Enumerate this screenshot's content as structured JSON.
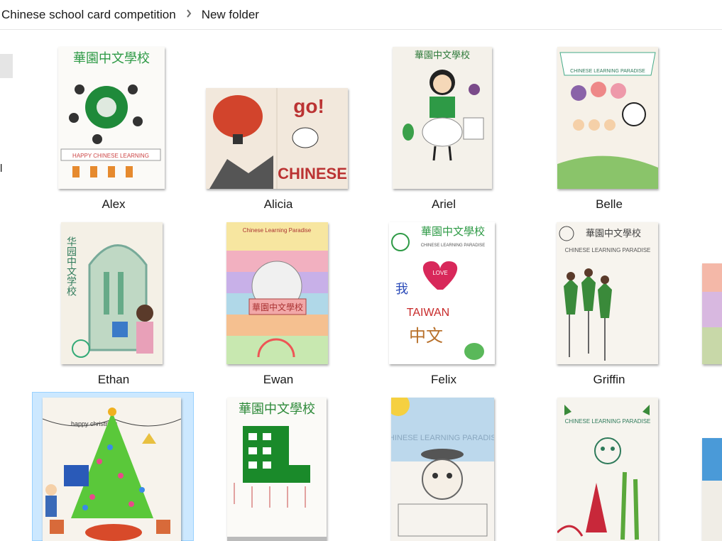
{
  "breadcrumb": {
    "items": [
      "Chinese school card competition",
      "New folder"
    ],
    "separator_icon": "chevron-right-icon"
  },
  "nav_pane": {
    "partial_label": "l"
  },
  "files": [
    {
      "name": "Alex"
    },
    {
      "name": "Alicia"
    },
    {
      "name": "Ariel"
    },
    {
      "name": "Belle"
    },
    {
      "name": "Ethan"
    },
    {
      "name": "Ewan"
    },
    {
      "name": "Felix"
    },
    {
      "name": "Griffin"
    }
  ],
  "thumbnail_text": {
    "school_name": "華園中文學校",
    "alex_banner": "HAPPY CHINESE LEARNING",
    "alicia_go": "go!",
    "alicia_chinese": "CHINESE",
    "belle_banner": "CHINESE LEARNING PARADISE",
    "ethan_vertical": "华园中文学校",
    "ewan_banner": "Chinese Learning Paradise",
    "felix_subtitle": "CHINESE LEARNING PARADISE",
    "felix_wo": "我",
    "felix_love": "LOVE",
    "felix_taiwan": "TAIWAN",
    "felix_zhongwen": "中文",
    "griffin_text": "CHINESE LEARNING PARADISE",
    "xmas_text": "happy christmas",
    "paradise_text": "CHINESE LEARNING PARADISE"
  },
  "selection": {
    "selected_tile_index": 8
  }
}
